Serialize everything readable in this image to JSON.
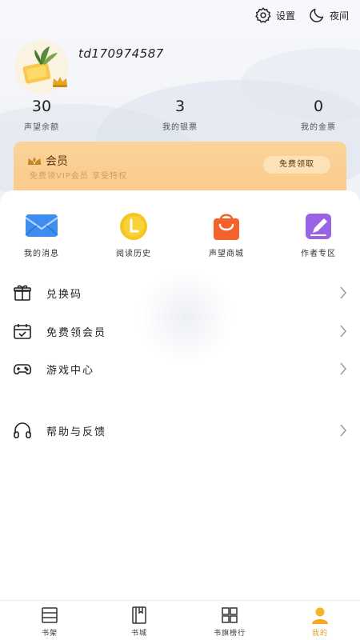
{
  "header": {
    "settings_label": "设置",
    "night_label": "夜间"
  },
  "user": {
    "username": "td170974587"
  },
  "stats": [
    {
      "value": "30",
      "label": "声望余额"
    },
    {
      "value": "3",
      "label": "我的银票"
    },
    {
      "value": "0",
      "label": "我的金票"
    }
  ],
  "vip": {
    "title": "会员",
    "subtitle": "免费领VIP会员 享受特权",
    "button": "免费领取"
  },
  "quick_actions": [
    {
      "label": "我的消息",
      "icon": "mail-icon"
    },
    {
      "label": "阅读历史",
      "icon": "history-icon"
    },
    {
      "label": "声望商城",
      "icon": "shop-bag-icon"
    },
    {
      "label": "作者专区",
      "icon": "author-edit-icon"
    }
  ],
  "menu": [
    {
      "label": "兑换码",
      "icon": "gift-icon"
    },
    {
      "label": "免费领会员",
      "icon": "calendar-check-icon"
    },
    {
      "label": "游戏中心",
      "icon": "gamepad-icon"
    },
    {
      "label": "帮助与反馈",
      "icon": "headset-icon"
    }
  ],
  "tabs": [
    {
      "label": "书架",
      "icon": "bookshelf-icon"
    },
    {
      "label": "书城",
      "icon": "book-icon"
    },
    {
      "label": "书旗榜行",
      "icon": "grid-icon"
    },
    {
      "label": "我的",
      "icon": "profile-icon",
      "active": true
    }
  ],
  "colors": {
    "accent": "#f5a623",
    "vip_bg": "#fbd39a",
    "mail_blue": "#3d8ef0",
    "history_yellow": "#f7c51e",
    "shop_orange": "#f5612b",
    "author_purple": "#9a63e6"
  }
}
